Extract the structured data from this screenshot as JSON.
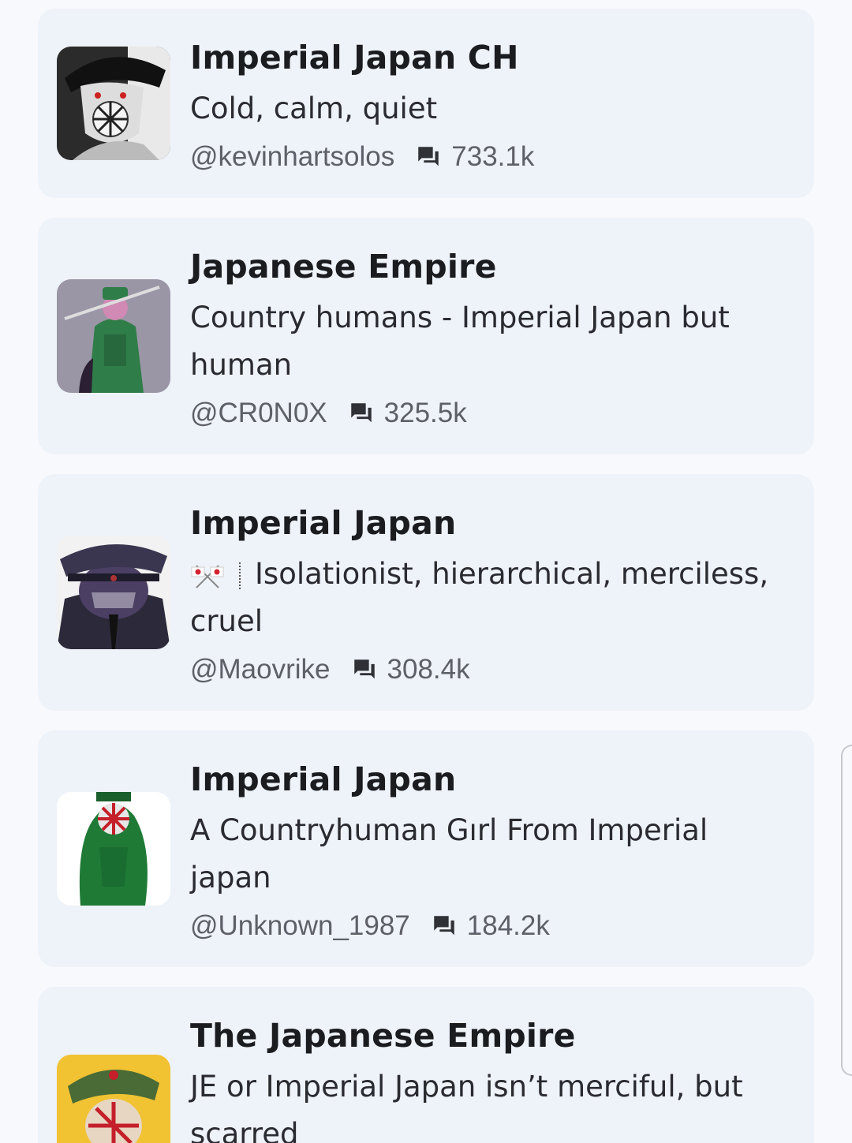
{
  "characters": [
    {
      "name": "Imperial Japan CH",
      "description": "Cold, calm, quiet",
      "author": "@kevinhartsolos",
      "chats": "733.1k",
      "avatar_icon": "character-avatar"
    },
    {
      "name": "Japanese Empire",
      "description": "Country humans - Imperial Japan but human",
      "author": "@CR0N0X",
      "chats": "325.5k",
      "avatar_icon": "character-avatar"
    },
    {
      "name": "Imperial Japan",
      "description_emoji": "crossed-flags-icon",
      "description": "Isolationist, hierarchical, merciless, cruel",
      "author": "@Maovrike",
      "chats": "308.4k",
      "avatar_icon": "character-avatar"
    },
    {
      "name": "Imperial Japan",
      "description": "A Countryhuman Gırl From Imperial japan",
      "author": "@Unknown_1987",
      "chats": "184.2k",
      "avatar_icon": "character-avatar"
    },
    {
      "name": "The Japanese Empire",
      "description": "JE or Imperial Japan isn’t merciful, but scarred",
      "author": "",
      "chats": "",
      "avatar_icon": "character-avatar"
    }
  ],
  "icons": {
    "chat_count": "chat-bubbles-icon"
  },
  "colors": {
    "card_background": "#eef2f9",
    "page_background": "#f8f9fd",
    "meta_text": "#5d6068"
  }
}
